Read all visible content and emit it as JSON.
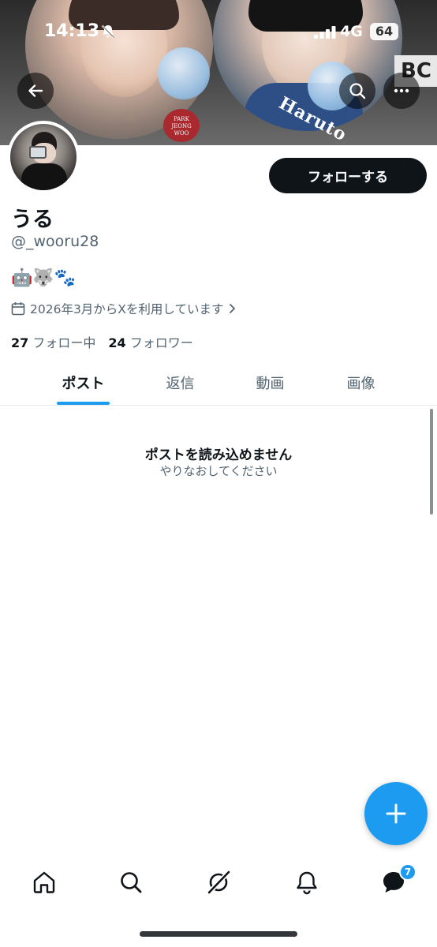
{
  "status_bar": {
    "time": "14:13",
    "network": "4G",
    "battery": "64"
  },
  "banner": {
    "sign_text": "BC",
    "sticker_text": [
      "PARK",
      "JEONG",
      "WOO"
    ],
    "tag_text": "Haruto"
  },
  "profile": {
    "display_name": "うる",
    "handle": "@_wooru28",
    "bio": "🤖🐺🐾",
    "joined": "2026年3月からXを利用しています",
    "following_count": "27",
    "following_label": "フォロー中",
    "followers_count": "24",
    "followers_label": "フォロワー",
    "follow_button_label": "フォローする"
  },
  "tabs": [
    {
      "label": "ポスト"
    },
    {
      "label": "返信"
    },
    {
      "label": "動画"
    },
    {
      "label": "画像"
    }
  ],
  "error": {
    "title": "ポストを読み込めません",
    "subtitle": "やりなおしてください"
  },
  "nav_badge": "7",
  "colors": {
    "accent": "#1d9bf0",
    "text": "#0f1419",
    "muted": "#536471"
  }
}
